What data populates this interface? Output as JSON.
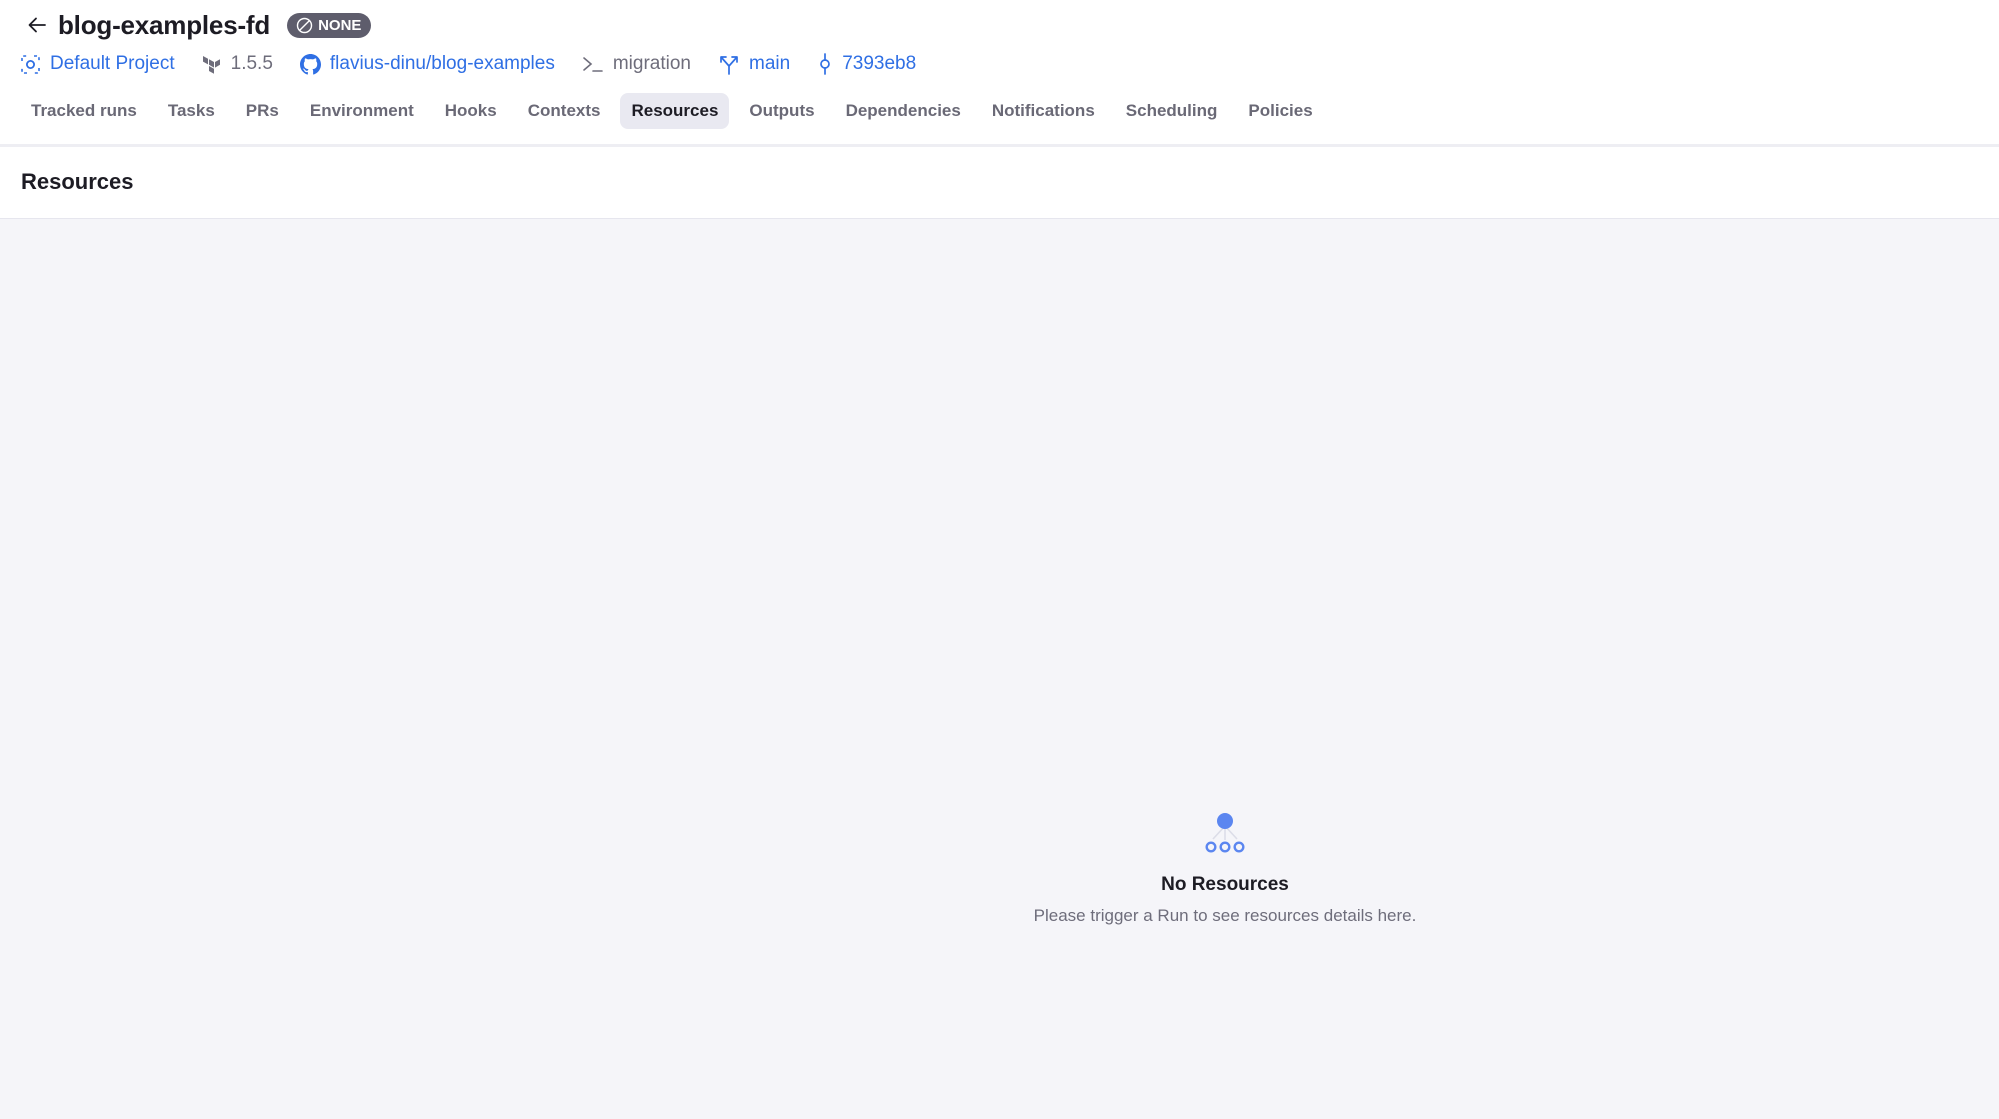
{
  "header": {
    "title": "blog-examples-fd",
    "status_badge": "NONE",
    "back_icon": "arrow-left-icon",
    "badge_icon": "circle-slash-icon"
  },
  "meta": {
    "project": {
      "label": "Default Project",
      "icon": "project-scan-icon"
    },
    "terraform_version": {
      "label": "1.5.5",
      "icon": "terraform-icon"
    },
    "repository": {
      "label": "flavius-dinu/blog-examples",
      "icon": "github-icon"
    },
    "path": {
      "label": "migration",
      "icon": "terminal-prompt-icon"
    },
    "branch": {
      "label": "main",
      "icon": "git-branch-icon"
    },
    "commit": {
      "label": "7393eb8",
      "icon": "git-commit-icon"
    }
  },
  "tabs": [
    {
      "label": "Tracked runs",
      "active": false
    },
    {
      "label": "Tasks",
      "active": false
    },
    {
      "label": "PRs",
      "active": false
    },
    {
      "label": "Environment",
      "active": false
    },
    {
      "label": "Hooks",
      "active": false
    },
    {
      "label": "Contexts",
      "active": false
    },
    {
      "label": "Resources",
      "active": true
    },
    {
      "label": "Outputs",
      "active": false
    },
    {
      "label": "Dependencies",
      "active": false
    },
    {
      "label": "Notifications",
      "active": false
    },
    {
      "label": "Scheduling",
      "active": false
    },
    {
      "label": "Policies",
      "active": false
    }
  ],
  "section": {
    "title": "Resources"
  },
  "empty_state": {
    "icon": "resource-tree-icon",
    "title": "No Resources",
    "message": "Please trigger a Run to see resources details here."
  },
  "colors": {
    "link": "#2f6fe4",
    "accent_icon": "#5b86f0",
    "badge_bg": "#5e5d6c",
    "active_tab_bg": "#e9e9f1",
    "page_bg": "#f5f5f9"
  }
}
